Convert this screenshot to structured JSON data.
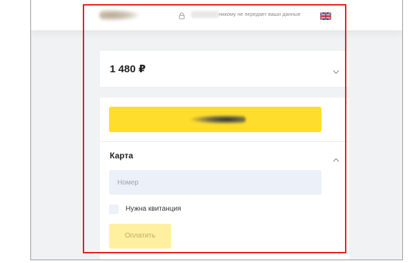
{
  "header": {
    "privacy_text": "никому не передает ваши данные",
    "logo_icon": "brand-logo-icon",
    "lock_icon": "lock-icon",
    "language_icon": "uk-flag-icon"
  },
  "order": {
    "amount": "1 480 ₽",
    "toggle_icon": "chevron-down-icon"
  },
  "payment": {
    "section_title": "Карта",
    "section_toggle_icon": "chevron-up-icon",
    "card_number_placeholder": "Номер",
    "receipt_label": "Нужна квитанция",
    "pay_button_label": "Оплатить"
  },
  "colors": {
    "accent_yellow": "#ffdd2d",
    "disabled_yellow": "#fff0a0",
    "input_background": "#ecf0f8",
    "page_background": "#f1f2f4",
    "annotation_red": "#e8191e"
  }
}
